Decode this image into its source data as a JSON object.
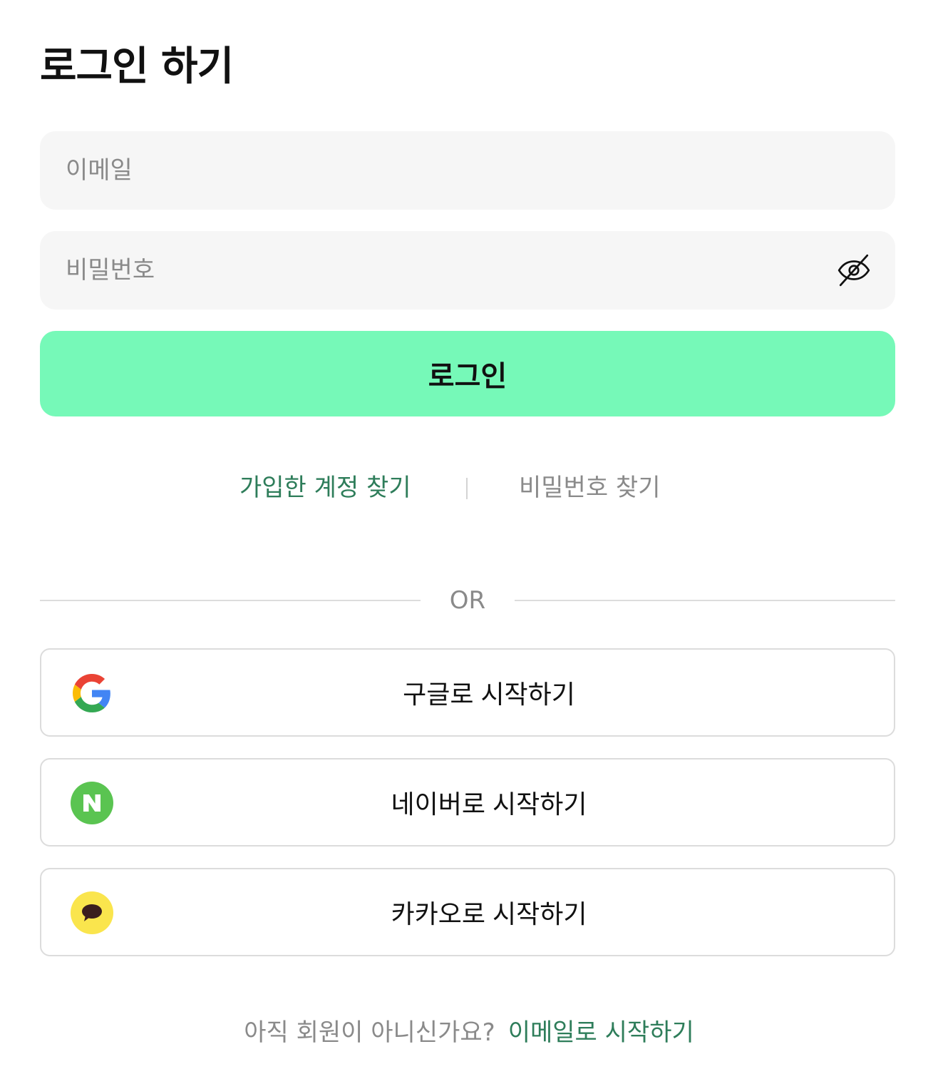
{
  "page": {
    "title": "로그인 하기"
  },
  "form": {
    "email": {
      "value": "",
      "placeholder": "이메일"
    },
    "password": {
      "value": "",
      "placeholder": "비밀번호",
      "toggle_icon": "eye-off-icon"
    },
    "login_label": "로그인"
  },
  "links": {
    "find_account": "가입한 계정 찾기",
    "find_password": "비밀번호 찾기"
  },
  "divider": {
    "label": "OR"
  },
  "social": [
    {
      "provider": "google",
      "label": "구글로 시작하기",
      "icon": "google-icon"
    },
    {
      "provider": "naver",
      "label": "네이버로 시작하기",
      "icon": "naver-icon"
    },
    {
      "provider": "kakao",
      "label": "카카오로 시작하기",
      "icon": "kakao-icon"
    }
  ],
  "signup": {
    "question": "아직 회원이 아니신가요?",
    "link": "이메일로 시작하기"
  },
  "colors": {
    "primary_button": "#76f9b8",
    "link_green": "#2e7d5a",
    "muted_text": "#8a8a8a",
    "field_bg": "#f6f6f6",
    "naver_green": "#5ac451",
    "kakao_yellow": "#fae54d"
  }
}
